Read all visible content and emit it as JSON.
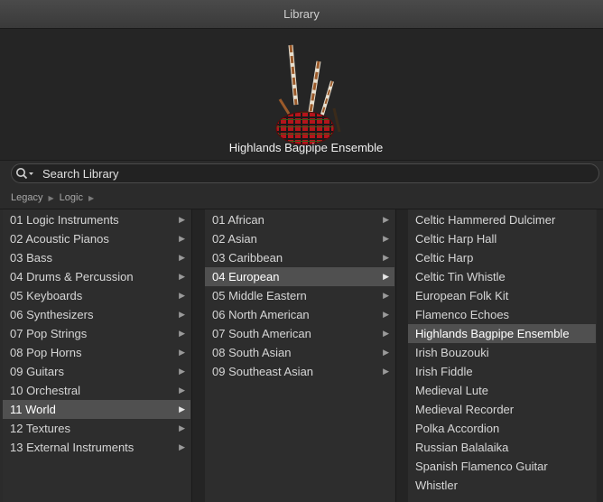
{
  "window": {
    "title": "Library"
  },
  "preview": {
    "patch_name": "Highlands Bagpipe Ensemble",
    "icon": "bagpipe-icon"
  },
  "search": {
    "placeholder": "Search Library",
    "value": ""
  },
  "breadcrumb": [
    "Legacy",
    "Logic"
  ],
  "columns": {
    "categories": [
      {
        "label": "01 Logic Instruments",
        "has_children": true
      },
      {
        "label": "02 Acoustic Pianos",
        "has_children": true
      },
      {
        "label": "03 Bass",
        "has_children": true
      },
      {
        "label": "04 Drums & Percussion",
        "has_children": true
      },
      {
        "label": "05 Keyboards",
        "has_children": true
      },
      {
        "label": "06 Synthesizers",
        "has_children": true
      },
      {
        "label": "07 Pop Strings",
        "has_children": true
      },
      {
        "label": "08 Pop Horns",
        "has_children": true
      },
      {
        "label": "09 Guitars",
        "has_children": true
      },
      {
        "label": "10 Orchestral",
        "has_children": true
      },
      {
        "label": "11 World",
        "has_children": true,
        "selected": true
      },
      {
        "label": "12 Textures",
        "has_children": true
      },
      {
        "label": "13 External Instruments",
        "has_children": true
      }
    ],
    "regions": [
      {
        "label": "01 African",
        "has_children": true
      },
      {
        "label": "02 Asian",
        "has_children": true
      },
      {
        "label": "03 Caribbean",
        "has_children": true
      },
      {
        "label": "04 European",
        "has_children": true,
        "selected": true
      },
      {
        "label": "05 Middle Eastern",
        "has_children": true
      },
      {
        "label": "06 North American",
        "has_children": true
      },
      {
        "label": "07 South American",
        "has_children": true
      },
      {
        "label": "08 South Asian",
        "has_children": true
      },
      {
        "label": "09 Southeast Asian",
        "has_children": true
      }
    ],
    "patches": [
      {
        "label": "Celtic Hammered Dulcimer"
      },
      {
        "label": "Celtic Harp Hall"
      },
      {
        "label": "Celtic Harp"
      },
      {
        "label": "Celtic Tin Whistle"
      },
      {
        "label": "European Folk Kit"
      },
      {
        "label": "Flamenco Echoes"
      },
      {
        "label": "Highlands Bagpipe Ensemble",
        "selected": true
      },
      {
        "label": "Irish Bouzouki"
      },
      {
        "label": "Irish Fiddle"
      },
      {
        "label": "Medieval Lute"
      },
      {
        "label": "Medieval Recorder"
      },
      {
        "label": "Polka Accordion"
      },
      {
        "label": "Russian Balalaika"
      },
      {
        "label": "Spanish Flamenco Guitar"
      },
      {
        "label": "Whistler"
      }
    ]
  },
  "colors": {
    "selection": "#505050",
    "background": "#2b2b2b"
  }
}
